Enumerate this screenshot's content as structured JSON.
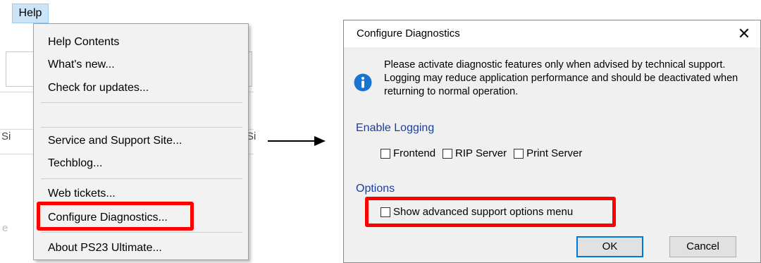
{
  "menubar": {
    "help_label": "Help"
  },
  "background": {
    "fragment_si_left": "Si",
    "fragment_si_right": "Si",
    "fragment_e": "e"
  },
  "help_menu": {
    "items": [
      {
        "label": "Help Contents"
      },
      {
        "label": "What's new..."
      },
      {
        "label": "Check for updates..."
      },
      {
        "label": ""
      },
      {
        "label": "Service and Support Site..."
      },
      {
        "label": "Techblog..."
      },
      {
        "label": "Web tickets..."
      },
      {
        "label": "Configure Diagnostics..."
      },
      {
        "label": "About PS23 Ultimate..."
      }
    ],
    "highlighted_item": "Configure Diagnostics..."
  },
  "dialog": {
    "title": "Configure Diagnostics",
    "close_glyph": "✕",
    "info_text": "Please activate diagnostic features only when advised by technical support. Logging may reduce application performance and should be deactivated when returning to normal operation.",
    "enable_logging": {
      "label": "Enable Logging",
      "options": [
        {
          "label": "Frontend",
          "checked": false
        },
        {
          "label": "RIP Server",
          "checked": false
        },
        {
          "label": "Print Server",
          "checked": false
        }
      ]
    },
    "options": {
      "label": "Options",
      "advanced_menu": {
        "label": "Show advanced support options menu",
        "checked": false
      }
    },
    "ok_label": "OK",
    "cancel_label": "Cancel"
  },
  "colors": {
    "highlight_red": "#ff0000",
    "section_blue": "#1a3f9f",
    "info_icon_blue": "#1a74d2",
    "default_button_border": "#0078d7",
    "menubar_active": "#cce4f7"
  }
}
